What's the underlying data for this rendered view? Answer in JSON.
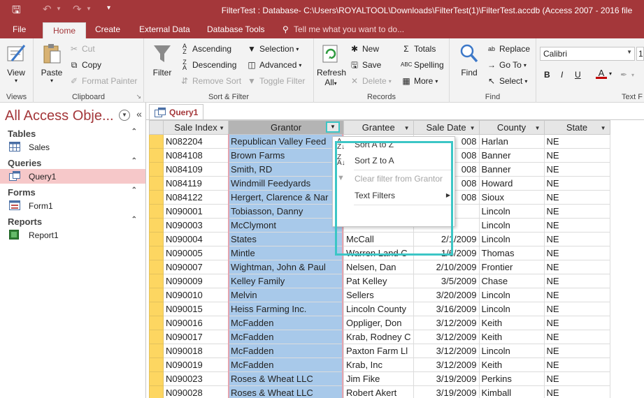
{
  "window": {
    "title": "FilterTest : Database- C:\\Users\\ROYALTOOL\\Downloads\\FilterTest(1)\\FilterTest.accdb (Access 2007 - 2016 file"
  },
  "ribbon_tabs": [
    "File",
    "Home",
    "Create",
    "External Data",
    "Database Tools"
  ],
  "active_tab": "Home",
  "tell_me": "Tell me what you want to do...",
  "groups": {
    "views": {
      "label": "Views",
      "view": "View"
    },
    "clipboard": {
      "label": "Clipboard",
      "paste": "Paste",
      "cut": "Cut",
      "copy": "Copy",
      "format_painter": "Format Painter"
    },
    "sort_filter": {
      "label": "Sort & Filter",
      "filter": "Filter",
      "ascending": "Ascending",
      "descending": "Descending",
      "remove_sort": "Remove Sort",
      "selection": "Selection",
      "advanced": "Advanced",
      "toggle_filter": "Toggle Filter"
    },
    "records": {
      "label": "Records",
      "refresh": "Refresh",
      "refresh_all": "All",
      "new": "New",
      "save": "Save",
      "delete": "Delete",
      "totals": "Totals",
      "spelling": "Spelling",
      "more": "More"
    },
    "find": {
      "label": "Find",
      "find": "Find",
      "replace": "Replace",
      "goto": "Go To",
      "select": "Select"
    },
    "text": {
      "label": "Text F",
      "font": "Calibri",
      "size": "1",
      "bold": "B",
      "italic": "I",
      "underline": "U"
    }
  },
  "nav": {
    "title": "All Access Obje...",
    "sections": [
      {
        "name": "Tables",
        "items": [
          "Sales"
        ]
      },
      {
        "name": "Queries",
        "items": [
          "Query1"
        ]
      },
      {
        "name": "Forms",
        "items": [
          "Form1"
        ]
      },
      {
        "name": "Reports",
        "items": [
          "Report1"
        ]
      }
    ]
  },
  "doc_tab": "Query1",
  "columns": [
    "Sale Index",
    "Grantor",
    "Grantee",
    "Sale Date",
    "County",
    "State"
  ],
  "rows": [
    [
      "N082204",
      "Republican Valley Feed",
      "",
      "008",
      "Harlan",
      "NE"
    ],
    [
      "N084108",
      "Brown Farms",
      "",
      "008",
      "Banner",
      "NE"
    ],
    [
      "N084109",
      "Smith, RD",
      "",
      "008",
      "Banner",
      "NE"
    ],
    [
      "N084119",
      "Windmill Feedyards",
      "",
      "008",
      "Howard",
      "NE"
    ],
    [
      "N084122",
      "Hergert, Clarence & Nar",
      "",
      "008",
      "Sioux",
      "NE"
    ],
    [
      "N090001",
      "Tobiasson, Danny",
      "",
      "",
      "Lincoln",
      "NE"
    ],
    [
      "N090003",
      "McClymont",
      "",
      "",
      "Lincoln",
      "NE"
    ],
    [
      "N090004",
      "States",
      "McCall",
      "2/1/2009",
      "Lincoln",
      "NE"
    ],
    [
      "N090005",
      "Mintle",
      "Warren Land C",
      "1/6/2009",
      "Thomas",
      "NE"
    ],
    [
      "N090007",
      "Wightman, John & Paul",
      "Nelsen, Dan",
      "2/10/2009",
      "Frontier",
      "NE"
    ],
    [
      "N090009",
      "Kelley Family",
      "Pat Kelley",
      "3/5/2009",
      "Chase",
      "NE"
    ],
    [
      "N090010",
      "Melvin",
      "Sellers",
      "3/20/2009",
      "Lincoln",
      "NE"
    ],
    [
      "N090015",
      "Heiss Farming Inc.",
      "Lincoln County",
      "3/16/2009",
      "Lincoln",
      "NE"
    ],
    [
      "N090016",
      "McFadden",
      "Oppliger, Don",
      "3/12/2009",
      "Keith",
      "NE"
    ],
    [
      "N090017",
      "McFadden",
      "Krab, Rodney C",
      "3/12/2009",
      "Keith",
      "NE"
    ],
    [
      "N090018",
      "McFadden",
      "Paxton Farm Ll",
      "3/12/2009",
      "Lincoln",
      "NE"
    ],
    [
      "N090019",
      "McFadden",
      "Krab, Inc",
      "3/12/2009",
      "Keith",
      "NE"
    ],
    [
      "N090023",
      "Roses & Wheat LLC",
      "Jim Fike",
      "3/19/2009",
      "Perkins",
      "NE"
    ],
    [
      "N090028",
      "Roses & Wheat LLC",
      "Robert Akert",
      "3/19/2009",
      "Kimball",
      "NE"
    ]
  ],
  "filter_menu": {
    "sort_az": "Sort A to Z",
    "sort_za": "Sort Z to A",
    "clear_filter": "Clear filter from Grantor",
    "text_filters": "Text Filters"
  },
  "colors": {
    "accent": "#a4373a",
    "highlight": "#3cc6c6",
    "selected_column": "#a8c9ea",
    "record_selector": "#fdd661"
  }
}
